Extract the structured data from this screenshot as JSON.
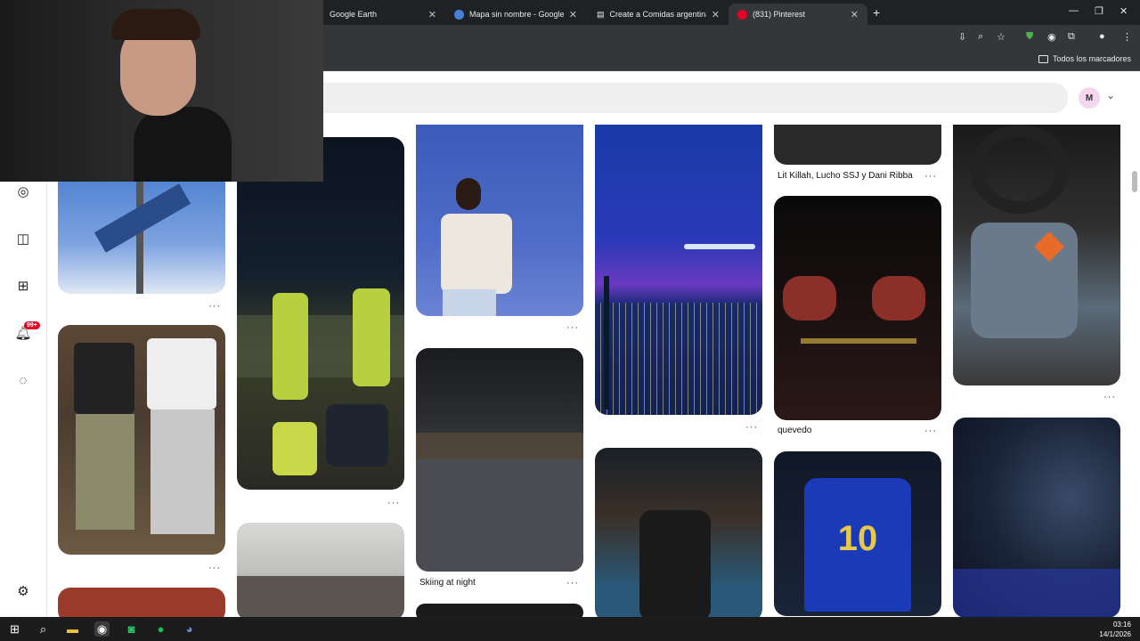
{
  "browser": {
    "tabs": [
      {
        "title": "Google Earth",
        "active": false
      },
      {
        "title": "Mapa sin nombre - Google Earth",
        "active": false
      },
      {
        "title": "Create a Comidas argentinas Ti",
        "active": false
      },
      {
        "title": "(831) Pinterest",
        "active": true
      }
    ],
    "new_tab_label": "+",
    "bookmarks": {
      "all_bookmarks_label": "Todos los marcadores"
    }
  },
  "header": {
    "avatar_initial": "M"
  },
  "sidebar": {
    "icons": [
      "compass-icon",
      "board-icon",
      "create-icon",
      "notifications-icon",
      "messages-icon",
      "settings-icon"
    ],
    "notification_badge": "99+"
  },
  "pins": {
    "captions": {
      "lit_killah": "Lit Killah, Lucho SSJ y Dani Ribba",
      "quevedo": "quevedo",
      "skiing": "Skiing at night"
    },
    "more_label": "···"
  },
  "taskbar": {
    "time": "03:16",
    "date": "14/1/2026"
  },
  "colors": {
    "brand": "#e60023",
    "chrome_dark": "#202124",
    "chrome_toolbar": "#35363a"
  }
}
